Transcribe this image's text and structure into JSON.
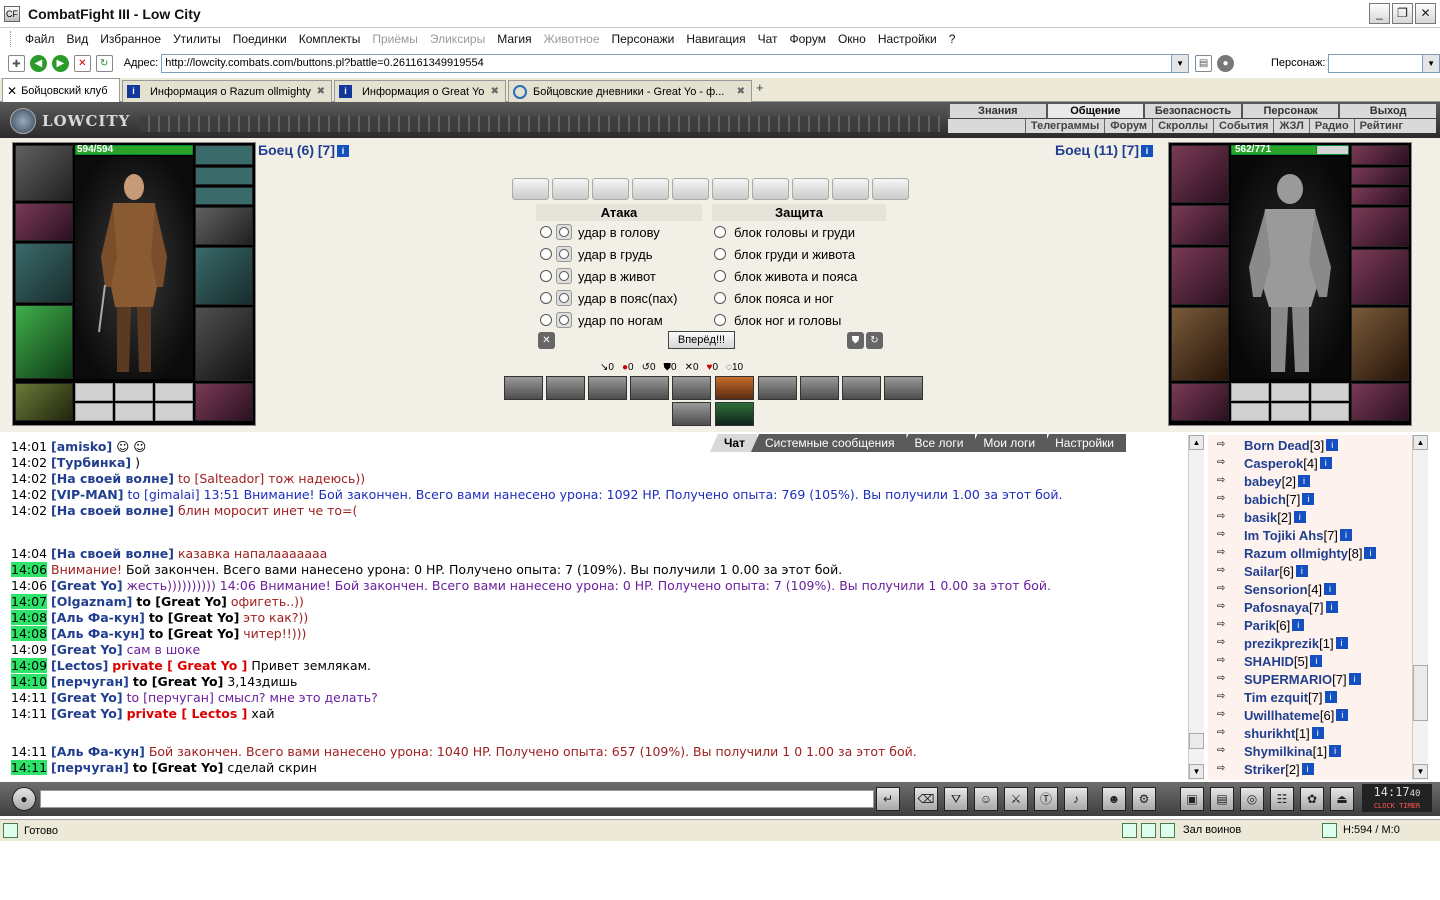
{
  "window": {
    "title": "CombatFight III - Low City",
    "icon": "CF"
  },
  "menu": [
    "Файл",
    "Вид",
    "Избранное",
    "Утилиты",
    "Поединки",
    "Комплекты",
    "Приёмы",
    "Эликсиры",
    "Магия",
    "Животное",
    "Персонажи",
    "Навигация",
    "Чат",
    "Форум",
    "Окно",
    "Настройки",
    "?"
  ],
  "menu_disabled": [
    "Приёмы",
    "Эликсиры",
    "Животное"
  ],
  "address": {
    "label": "Адрес:",
    "url": "http://lowcity.combats.com/buttons.pl?battle=0.261161349919554",
    "persona_label": "Персонаж:"
  },
  "tabs": [
    {
      "label": "Бойцовский клуб",
      "active": true
    },
    {
      "label": "Информация о Razum ollmighty",
      "active": false
    },
    {
      "label": "Информация о Great Yo",
      "active": false
    },
    {
      "label": "Бойцовские дневники - Great Yo - ф...",
      "active": false
    }
  ],
  "game": {
    "logo": "LOWCITY",
    "top_nav": [
      "Знания",
      "Общение",
      "Безопасность",
      "Персонаж",
      "Выход"
    ],
    "top_nav_active": "Общение",
    "sub_nav": [
      "Телеграммы",
      "Форум",
      "Скроллы",
      "События",
      "ЖЗЛ",
      "Радио",
      "Рейтинг"
    ]
  },
  "fighter_left": {
    "name": "Боец (6) [7]",
    "hp": "594/594",
    "hp_fraction": 1.0
  },
  "fighter_right": {
    "name": "Боец (11) [7]",
    "hp": "562/771",
    "hp_fraction": 0.729
  },
  "attack": {
    "title": "Атака",
    "items": [
      "удар в голову",
      "удар в грудь",
      "удар в живот",
      "удар в пояс(пах)",
      "удар по ногам"
    ]
  },
  "defense": {
    "title": "Защита",
    "items": [
      "блок головы и груди",
      "блок груди и живота",
      "блок живота и пояса",
      "блок пояса и ног",
      "блок ног и головы"
    ]
  },
  "go_button": "Вперёд!!!",
  "stats": [
    "0",
    "0",
    "0",
    "0",
    "0",
    "0",
    "10"
  ],
  "chat_tabs": [
    "Чат",
    "Системные сообщения",
    "Все логи",
    "Мои логи",
    "Настройки"
  ],
  "chat": [
    {
      "ts": "14:01",
      "nick": "amisko",
      "text": "",
      "emote": true,
      "hl": false
    },
    {
      "ts": "14:02",
      "nick": "Турбинка",
      "text": ")",
      "hl": false
    },
    {
      "ts": "14:02",
      "nick": "На своей волне",
      "text": "to [Salteador] тож надеюсь))",
      "cls": "msg-red",
      "hl": false
    },
    {
      "ts": "14:02",
      "nick": "VIP-MAN",
      "text": "to [gimalai] 13:51 Внимание! Бой закончен. Всего вами нанесено урона: 1092 HP. Получено опыта: 769 (105%). Вы получили 1.00 за этот бой.",
      "cls": "msg-blue",
      "hl": false
    },
    {
      "ts": "14:02",
      "nick": "На своей волне",
      "text": "блин моросит инет че то=(",
      "cls": "msg-red",
      "hl": false
    },
    {
      "ts": "14:04",
      "nick": "На своей волне",
      "text": "казавка напалааааааа",
      "cls": "msg-red",
      "hl": false
    },
    {
      "ts": "14:06",
      "nick": "",
      "sys": "Внимание!",
      "text": "Бой закончен. Всего вами нанесено урона: 0 HP. Получено опыта: 7 (109%). Вы получили 1 0.00 за этот бой.",
      "hl": true
    },
    {
      "ts": "14:06",
      "nick": "Great Yo",
      "text": "жесть)))))))))) 14:06 Внимание! Бой закончен. Всего вами нанесено урона: 0 HP. Получено опыта: 7 (109%). Вы получили 1 0.00 за этот бой.",
      "cls": "msg-purple",
      "hl": false
    },
    {
      "ts": "14:07",
      "nick": "Olgaznam",
      "to": "to [Great Yo]",
      "text": "офигеть..))",
      "cls": "msg-red",
      "hl": true
    },
    {
      "ts": "14:08",
      "nick": "Аль Фа-кун",
      "to": "to [Great Yo]",
      "text": "это как?))",
      "cls": "msg-red",
      "hl": true
    },
    {
      "ts": "14:08",
      "nick": "Аль Фа-кун",
      "to": "to [Great Yo]",
      "text": "читер!!)))",
      "cls": "msg-red",
      "hl": true
    },
    {
      "ts": "14:09",
      "nick": "Great Yo",
      "text": "сам в шоке",
      "cls": "msg-purple",
      "hl": false
    },
    {
      "ts": "14:09",
      "nick": "Lectos",
      "priv": "private [ Great Yo ]",
      "text": "Привет землякам.",
      "hl": true
    },
    {
      "ts": "14:10",
      "nick": "перчуган",
      "to": "to [Great Yo]",
      "text": "3,14здишь",
      "hl": true
    },
    {
      "ts": "14:11",
      "nick": "Great Yo",
      "text": "to [перчуган] смысл? мне это делать?",
      "cls": "msg-purple",
      "hl": false
    },
    {
      "ts": "14:11",
      "nick": "Great Yo",
      "priv": "private [ Lectos ]",
      "text": "хай",
      "hl": false
    },
    {
      "ts": "14:11",
      "nick": "Аль Фа-кун",
      "text": "Бой закончен. Всего вами нанесено урона: 1040 HP. Получено опыта: 657 (109%). Вы получили 1 0 1.00 за этот бой.",
      "cls": "msg-red",
      "hl": false
    },
    {
      "ts": "14:11",
      "nick": "перчуган",
      "to": "to [Great Yo]",
      "text": "сделай скрин",
      "hl": true
    }
  ],
  "users": [
    {
      "name": "Born Dead",
      "level": "[3]"
    },
    {
      "name": "Casperok",
      "level": "[4]"
    },
    {
      "name": "babey",
      "level": "[2]"
    },
    {
      "name": "babich",
      "level": "[7]"
    },
    {
      "name": "basik",
      "level": "[2]"
    },
    {
      "name": "Im Tojiki Ahs",
      "level": "[7]"
    },
    {
      "name": "Razum ollmighty",
      "level": "[8]"
    },
    {
      "name": "Sailar",
      "level": "[6]"
    },
    {
      "name": "Sensorion",
      "level": "[4]"
    },
    {
      "name": "Pafosnaya",
      "level": "[7]"
    },
    {
      "name": "Parik",
      "level": "[6]"
    },
    {
      "name": "prezikprezik",
      "level": "[1]"
    },
    {
      "name": "SHAHID",
      "level": "[5]"
    },
    {
      "name": "SUPERMARIO",
      "level": "[7]"
    },
    {
      "name": "Tim ezquit",
      "level": "[7]"
    },
    {
      "name": "Uwillhateme",
      "level": "[6]"
    },
    {
      "name": "shurikht",
      "level": "[1]"
    },
    {
      "name": "Shymilkina",
      "level": "[1]"
    },
    {
      "name": "Striker",
      "level": "[2]"
    }
  ],
  "clock": {
    "time": "14:17",
    "seconds": "40",
    "labels": "CLOCK TIMER"
  },
  "status": {
    "text": "Готово",
    "zone": "Зал воинов",
    "hp": "H:594 / M:0"
  }
}
